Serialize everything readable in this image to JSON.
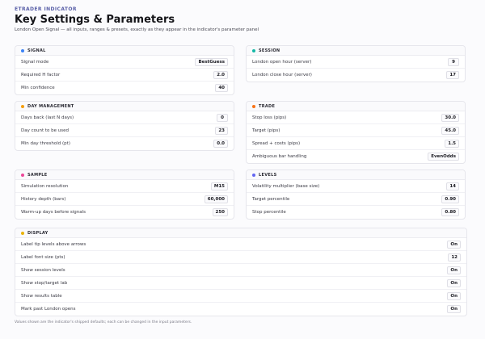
{
  "header": {
    "brand": "ETRADER INDICATOR",
    "title": "Key Settings & Parameters",
    "subtitle": "London Open Signal — all inputs, ranges & presets, exactly as they appear in the indicator's parameter panel"
  },
  "colors": {
    "signal": "#3b82f6",
    "session": "#14b8a6",
    "day": "#f59e0b",
    "trade": "#f97316",
    "sample": "#ec4899",
    "levels": "#6366f1",
    "display": "#eab308"
  },
  "cards": {
    "signal": {
      "title": "Signal",
      "rows": [
        {
          "label": "Signal mode",
          "value": "BestGuess"
        },
        {
          "label": "Required H factor",
          "value": "2.0"
        },
        {
          "label": "Min confidence",
          "value": "40"
        }
      ]
    },
    "session": {
      "title": "Session",
      "rows": [
        {
          "label": "London open hour (server)",
          "value": "9"
        },
        {
          "label": "London close hour (server)",
          "value": "17"
        }
      ]
    },
    "day": {
      "title": "Day management",
      "rows": [
        {
          "label": "Days back (last N days)",
          "value": "0"
        },
        {
          "label": "Day count to be used",
          "value": "23"
        },
        {
          "label": "Min day threshold (pt)",
          "value": "0.0"
        }
      ]
    },
    "trade": {
      "title": "Trade",
      "rows": [
        {
          "label": "Stop loss (pips)",
          "value": "30.0"
        },
        {
          "label": "Target (pips)",
          "value": "45.0"
        },
        {
          "label": "Spread + costs (pips)",
          "value": "1.5"
        },
        {
          "label": "Ambiguous bar handling",
          "value": "EvenOdds"
        }
      ]
    },
    "sample": {
      "title": "Sample",
      "rows": [
        {
          "label": "Simulation resolution",
          "value": "M15"
        },
        {
          "label": "History depth (bars)",
          "value": "60,000"
        },
        {
          "label": "Warm-up days before signals",
          "value": "250"
        }
      ]
    },
    "levels": {
      "title": "Levels",
      "rows": [
        {
          "label": "Volatility multiplier (base size)",
          "value": "14"
        },
        {
          "label": "Target percentile",
          "value": "0.90"
        },
        {
          "label": "Stop percentile",
          "value": "0.80"
        }
      ]
    },
    "display": {
      "title": "Display",
      "rows": [
        {
          "label": "Label tip levels above arrows",
          "value": "On"
        },
        {
          "label": "Label font size (pts)",
          "value": "12"
        },
        {
          "label": "Show session levels",
          "value": "On"
        },
        {
          "label": "Show stop/target lab",
          "value": "On"
        },
        {
          "label": "Show results table",
          "value": "On"
        },
        {
          "label": "Mark past London opens",
          "value": "On"
        }
      ]
    }
  },
  "footer": "Values shown are the indicator's shipped defaults; each can be changed in the input parameters."
}
